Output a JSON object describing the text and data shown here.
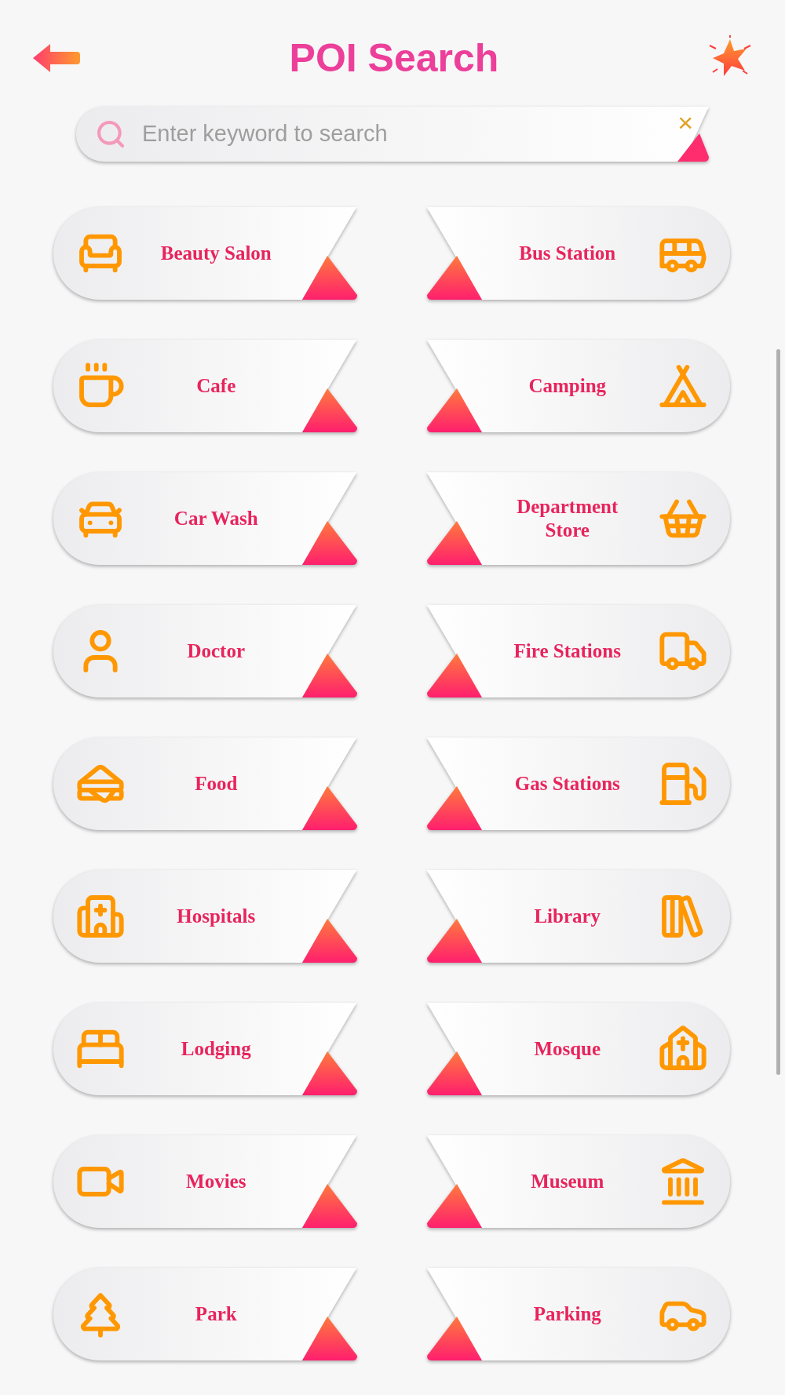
{
  "header": {
    "title": "POI Search"
  },
  "search": {
    "placeholder": "Enter keyword to search",
    "clear": "×"
  },
  "categories": [
    {
      "label": "Beauty Salon"
    },
    {
      "label": "Bus Station"
    },
    {
      "label": "Cafe"
    },
    {
      "label": "Camping"
    },
    {
      "label": "Car Wash"
    },
    {
      "label": "Department Store"
    },
    {
      "label": "Doctor"
    },
    {
      "label": "Fire Stations"
    },
    {
      "label": "Food"
    },
    {
      "label": "Gas Stations"
    },
    {
      "label": "Hospitals"
    },
    {
      "label": "Library"
    },
    {
      "label": "Lodging"
    },
    {
      "label": "Mosque"
    },
    {
      "label": "Movies"
    },
    {
      "label": "Museum"
    },
    {
      "label": "Park"
    },
    {
      "label": "Parking"
    }
  ]
}
